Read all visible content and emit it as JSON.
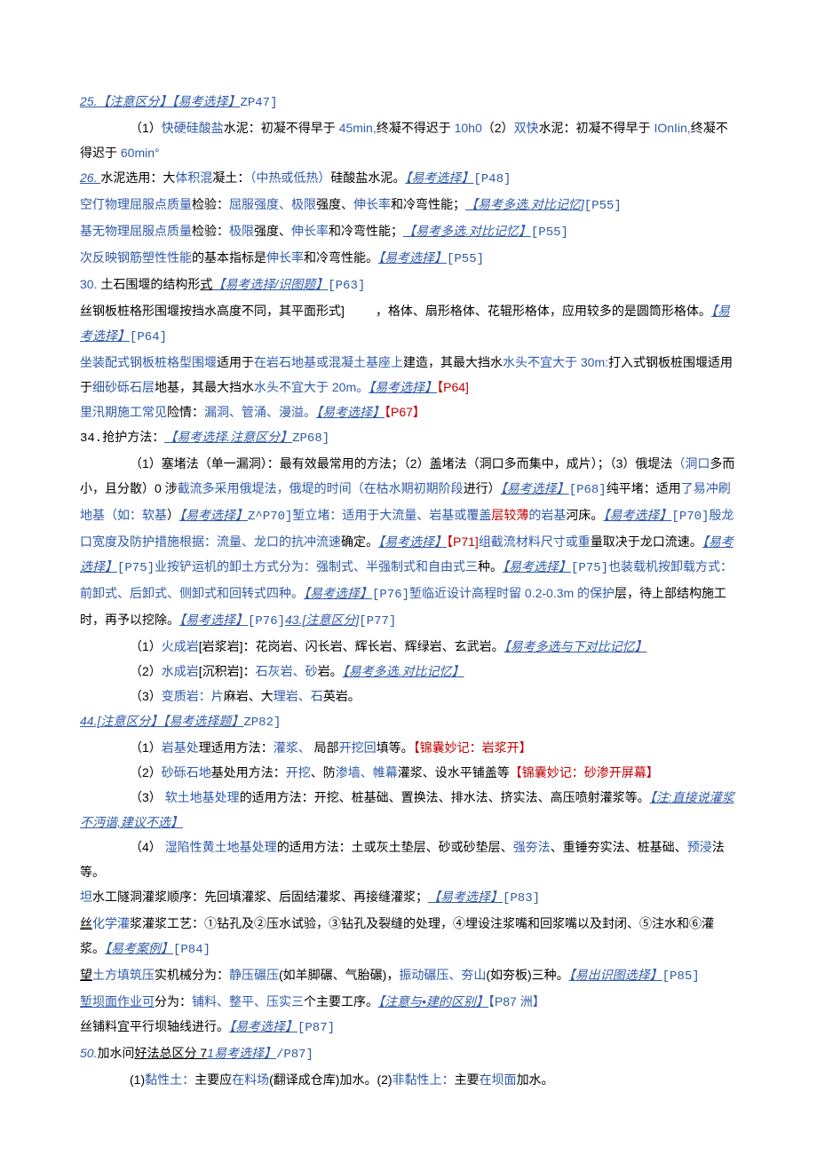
{
  "p1": {
    "a": "25.【注意区分】【易考选择】",
    "b": "ZP47]"
  },
  "p2": {
    "a": "（1）",
    "b": "快硬硅酸盐",
    "c": "水泥：初凝不得早于 ",
    "d": "45min,",
    "e": "终凝不得迟于 ",
    "f": "10h0",
    "g": "（2）",
    "h": "双快",
    "i": "水泥：初凝不得早于 ",
    "j": "IOnIin,",
    "k": "终凝不得迟于 ",
    "l": "60min°"
  },
  "p3": {
    "a": "26. ",
    "b": "水泥选用：大",
    "c": "体积混",
    "d": "凝土：",
    "e": "（中热或低热）",
    "f": "硅酸盐水泥。",
    "g": "【易考选择】",
    "h": "[P48]"
  },
  "p4": {
    "a": "空仃物理屈服点质量",
    "b": "检验：",
    "c": "屈服强度、极限",
    "d": "强度、",
    "e": "伸长率",
    "f": "和冷弯",
    "g": "性能；",
    "h": "【易考多选.对比记忆]",
    "i": "[P55]"
  },
  "p5": {
    "a": "基无物理屈服点质量",
    "b": "检验：",
    "c": "极限",
    "d": "强度、",
    "e": "伸长率",
    "f": "和冷弯",
    "g": "性能；",
    "h": "【易考多选.对比记忆】",
    "i": "[P55]"
  },
  "p6": {
    "a": "次反映钢筋塑性性能",
    "b": "的基本指标是",
    "c": "伸长率",
    "d": "和冷弯性能。",
    "e": "【易考选择】",
    "f": "[P55]"
  },
  "p7": {
    "a": "30. ",
    "b": "土石围堰的结构形",
    "c": "式",
    "d": "【易考选择/识图题】",
    "e": "[P63]"
  },
  "p8": {
    "a": "丝钢板桩格形围堰按挡水高度不同，其平面形式]",
    "b": "         ，格体、扇形格体、花辊形格体，应用较多的是圆筒形格体。",
    "c": "【易考选择】",
    "d": "[P64]"
  },
  "p9": {
    "a": "坐装配式钢板桩格型围堰",
    "b": "适用于",
    "c": "在岩石地基或混凝土基座上",
    "d": "建造，其最大挡水",
    "e": "水头不宜大于 30m:",
    "f": "打入式钢板桩围堰",
    "g": "适用于",
    "h": "细砂砾石层",
    "i": "地基，其最大挡水",
    "j": "水头不宜大于 20m。",
    "k": "【易考选择】",
    "l": "【P64]"
  },
  "p10": {
    "a": "里汛期施工常见",
    "b": "险情：",
    "c": "漏洞、管涌、漫溢。",
    "d": "【易考选择】",
    "e": "【P67】"
  },
  "p11": {
    "a": "34.",
    "b": "抢护方法：",
    "c": "【易考选择.注意区分】",
    "d": "ZP68]"
  },
  "p12": {
    "a": "（1）塞堵法（单一漏洞）：最有效最常用的方法；（2）盖堵法（洞口多而集中，成片）；（3）俄堤法",
    "b": "（洞口",
    "c": "多而小，且分散",
    "d": "）0 涉",
    "e": "截流多采用俄堤法，俄堤的时间（",
    "f": "在枯水期初期阶段",
    "g": "进行）",
    "h": "【易考选择】",
    "i": "[P68]",
    "j": "纯平堵：适用",
    "k": "了易冲刷地基（如：",
    "l": "软基",
    "m": "）",
    "n": "【易考选择】",
    "o": "Z^P70]",
    "p": "堑立堵：适",
    "q": "用于大流量、岩基或覆盖",
    "r": "层较薄",
    "s": "的岩基",
    "t": "河床。",
    "u": "【易考选择】",
    "v": "[P70]",
    "w": "殷龙口宽度及防护措施根据：",
    "x": "流量、龙口的抗冲流速",
    "y": "确定。",
    "z": "【易考选择】",
    "aa": "【P71]",
    "ab": "组截流材料尺寸或重",
    "ac": "量取决于龙口流速。",
    "ad": "【易考选择】",
    "ae": "[P75]",
    "af": "业按铲运机的卸土方式分为：",
    "ag": "强制式、半强制式和自由式三",
    "ah": "种。",
    "ai": "【易考选择】",
    "aj": "[P75]",
    "ak": "也装载机按卸载方式：前卸式、后卸式、侧卸式和回转式四种。",
    "al": "【易考选择】",
    "am": "[P76]",
    "an": "堑临近设计高程时留 0.2-0.3m 的保护",
    "ao": "层，待上部结构施工时，再予以挖除。",
    "ap": "【易考选择】",
    "aq": "[P76]",
    "ar": "43.[注意区分]",
    "as": "[P77]"
  },
  "p13": {
    "a": "（1）",
    "b": "火成岩",
    "c": "[岩浆岩]：花岗岩、闪长岩、辉长岩、辉绿岩、玄武岩。",
    "d": "【易考多选与下对比记忆】"
  },
  "p14": {
    "a": "（2）",
    "b": "水成岩",
    "c": "[沉积岩]：",
    "d": "石灰岩、砂",
    "e": "岩。",
    "f": "【易考多选.对比记忆】"
  },
  "p15": {
    "a": "（3）",
    "b": "变质岩：片",
    "c": "麻岩、大",
    "d": "理岩、石",
    "e": "英岩。"
  },
  "p16": {
    "a": "44.[注意区分】【易考选择题】",
    "b": "ZP82]"
  },
  "p17": {
    "a": "（1）",
    "b": "岩基处",
    "c": "理适用方法：",
    "d": "灌浆、",
    "e": " 局部",
    "f": "开挖回",
    "g": "填等。",
    "h": "【锦囊妙记：岩浆开】"
  },
  "p18": {
    "a": "（2）",
    "b": "砂砾石地",
    "c": "基处用方法：",
    "d": "开挖",
    "e": "、防",
    "f": "渗墙、帷幕",
    "g": "灌浆、设水平铺盖等",
    "h": "【锦囊妙记：砂渗开屏幕】"
  },
  "p19": {
    "a": "（3） ",
    "b": "软土地基处理",
    "c": "的适用方法：开挖、桩基础、置换法、排水法、挤实法、高压喷射灌浆等。",
    "d": "【注:直接说灌浆不沔谐,建议不选】"
  },
  "p20": {
    "a": "（4） ",
    "b": "湿陷性黄土地基处理",
    "c": "的适用方法：土或灰土垫层、砂或砂垫层、",
    "d": "强夯法",
    "e": "、重锤夯实法、桩基础、",
    "f": "预浸",
    "g": "法等。"
  },
  "p21": {
    "a": "坦",
    "b": "水工隧洞灌浆顺序：先回填灌浆、后固结灌浆、再接缝灌浆；",
    "c": "【易考选择】",
    "d": "[P83]"
  },
  "p22": {
    "a": "丝",
    "b": "化学灌",
    "c": "浆灌浆工艺：①钻孔及②压水试验，③钻孔及裂缝的处理，④埋设注浆嘴和回浆嘴以及封闭、⑤注水和⑥灌浆。",
    "d": "【易考案例】",
    "e": "[P84]"
  },
  "p23": {
    "a": "望",
    "b": "土方填筑压",
    "c": "实机械分为：",
    "d": "静压碾压",
    "e": "(如羊脚碾、气胎碾)，",
    "f": "振动碾压、夯山",
    "g": "(如夯板)三种。",
    "h": "【易出识图选择】",
    "i": "[P85]"
  },
  "p24": {
    "a": "堑坝面作业可",
    "b": "分为：",
    "c": "铺料、整平、压实三",
    "d": "个主要工序。",
    "e": "【注意与•建的区别】",
    "f": "【P87 洲】"
  },
  "p25": {
    "a": "丝铺料宜平行坝轴线进行。",
    "b": "【易考选择】",
    "c": "[P87]"
  },
  "p26": {
    "a": "50.",
    "b": "加水问",
    "c": "好法总区分 7",
    "d": "1易考选择】",
    "e": "/P87]"
  },
  "p27": {
    "a": "(1)",
    "b": "黏性土：",
    "c": "主要应",
    "d": "在料场",
    "e": "(翻译成仓库)加水。(2)",
    "f": "非黏性上：",
    "g": "主要",
    "h": "在坝面",
    "i": "加水。"
  }
}
